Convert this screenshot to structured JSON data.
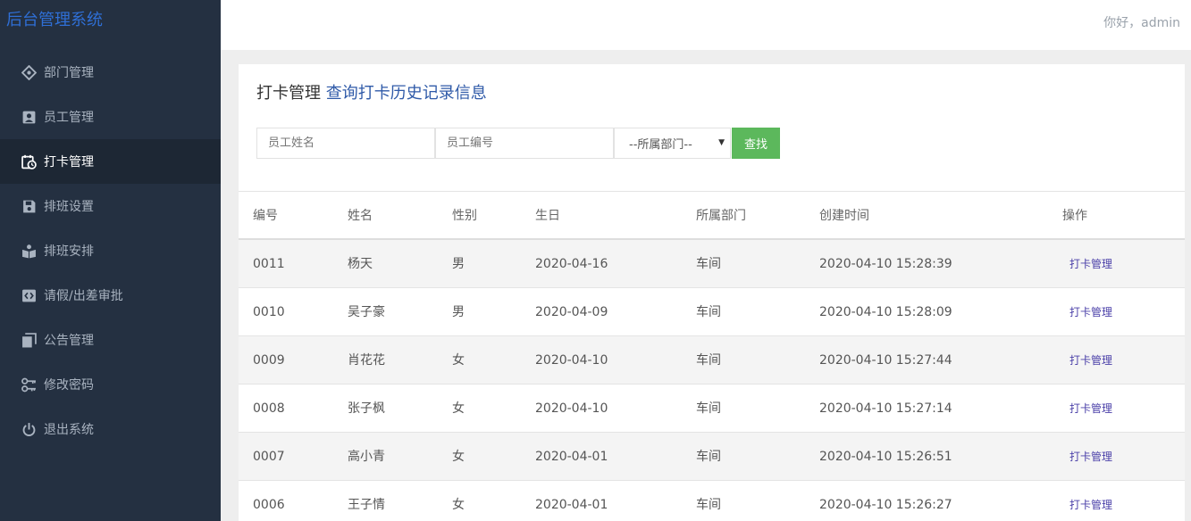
{
  "sidebar": {
    "brand": "后台管理系统",
    "items": [
      {
        "label": "部门管理",
        "icon": "dept-icon"
      },
      {
        "label": "员工管理",
        "icon": "employee-icon"
      },
      {
        "label": "打卡管理",
        "icon": "calendar-clock-icon",
        "active": true
      },
      {
        "label": "排班设置",
        "icon": "save-icon"
      },
      {
        "label": "排班安排",
        "icon": "reader-icon"
      },
      {
        "label": "请假/出差审批",
        "icon": "code-icon"
      },
      {
        "label": "公告管理",
        "icon": "documents-icon"
      },
      {
        "label": "修改密码",
        "icon": "keys-icon"
      },
      {
        "label": "退出系统",
        "icon": "power-icon"
      }
    ]
  },
  "topbar": {
    "greeting": "你好，admin"
  },
  "page": {
    "title": "打卡管理",
    "subtitle": "查询打卡历史记录信息"
  },
  "search": {
    "name_placeholder": "员工姓名",
    "code_placeholder": "员工编号",
    "dept_selected": "--所属部门--",
    "find_label": "查找"
  },
  "table": {
    "headers": [
      "编号",
      "姓名",
      "性别",
      "生日",
      "所属部门",
      "创建时间",
      "操作"
    ],
    "rows": [
      [
        "0011",
        "杨天",
        "男",
        "2020-04-16",
        "车间",
        "2020-04-10 15:28:39",
        "打卡管理"
      ],
      [
        "0010",
        "吴子豪",
        "男",
        "2020-04-09",
        "车间",
        "2020-04-10 15:28:09",
        "打卡管理"
      ],
      [
        "0009",
        "肖花花",
        "女",
        "2020-04-10",
        "车间",
        "2020-04-10 15:27:44",
        "打卡管理"
      ],
      [
        "0008",
        "张子枫",
        "女",
        "2020-04-10",
        "车间",
        "2020-04-10 15:27:14",
        "打卡管理"
      ],
      [
        "0007",
        "高小青",
        "女",
        "2020-04-01",
        "车间",
        "2020-04-10 15:26:51",
        "打卡管理"
      ],
      [
        "0006",
        "王子情",
        "女",
        "2020-04-01",
        "车间",
        "2020-04-10 15:26:27",
        "打卡管理"
      ]
    ]
  },
  "colors": {
    "sidebar_bg": "#243041",
    "accent": "#2f6fd6",
    "find_button": "#5cb85c",
    "action_link": "#4a3fa8"
  }
}
